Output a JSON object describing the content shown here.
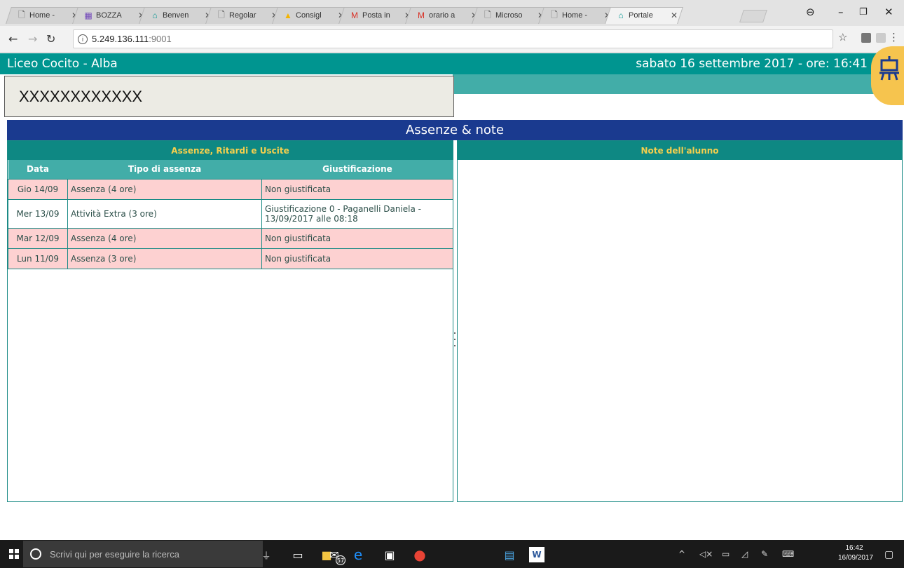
{
  "browser": {
    "tabs": [
      {
        "label": "Home -",
        "icon": "page-icon"
      },
      {
        "label": "BOZZA",
        "icon": "sheets-icon"
      },
      {
        "label": "Benven",
        "icon": "easel-icon"
      },
      {
        "label": "Regolar",
        "icon": "page-icon"
      },
      {
        "label": "Consigl",
        "icon": "drive-icon"
      },
      {
        "label": "Posta in",
        "icon": "gmail-icon"
      },
      {
        "label": "orario a",
        "icon": "gmail-icon"
      },
      {
        "label": "Microso",
        "icon": "page-icon"
      },
      {
        "label": "Home -",
        "icon": "page-icon"
      },
      {
        "label": "Portale",
        "icon": "easel-icon"
      }
    ],
    "tab_close": "✕",
    "address_host": "5.249.136.111",
    "address_port": ":9001",
    "colors": {
      "tabstrip": "#e3e3e3",
      "toolbar": "#f2f2f2"
    }
  },
  "page": {
    "school_name": "Liceo Cocito - Alba",
    "datetime": "sabato 16 settembre 2017 - ore: 16:41",
    "student_name": "XXXXXXXXXXXX",
    "section_title": "Assenze & note",
    "colors": {
      "header": "#009590",
      "section": "#1a3a8f",
      "panel_head_text": "#f5cf4d",
      "absence_row": "#fdd1d1"
    },
    "absences_panel": {
      "title": "Assenze, Ritardi e Uscite",
      "columns": [
        "Data",
        "Tipo di assenza",
        "Giustificazione"
      ],
      "rows": [
        {
          "date": "Gio 14/09",
          "type": "Assenza (4 ore)",
          "justification": "Non giustificata",
          "kind": "abs"
        },
        {
          "date": "Mer 13/09",
          "type": "Attività Extra (3 ore)",
          "justification": "Giustificazione 0 - Paganelli Daniela - 13/09/2017 alle 08:18",
          "kind": "extra"
        },
        {
          "date": "Mar 12/09",
          "type": "Assenza (4 ore)",
          "justification": "Non giustificata",
          "kind": "abs"
        },
        {
          "date": "Lun 11/09",
          "type": "Assenza (3 ore)",
          "justification": "Non giustificata",
          "kind": "abs"
        }
      ]
    },
    "notes_panel": {
      "title": "Note dell'alunno"
    }
  },
  "taskbar": {
    "search_placeholder": "Scrivi qui per eseguire la ricerca",
    "mail_badge": "57",
    "clock_time": "16:42",
    "clock_date": "16/09/2017"
  }
}
